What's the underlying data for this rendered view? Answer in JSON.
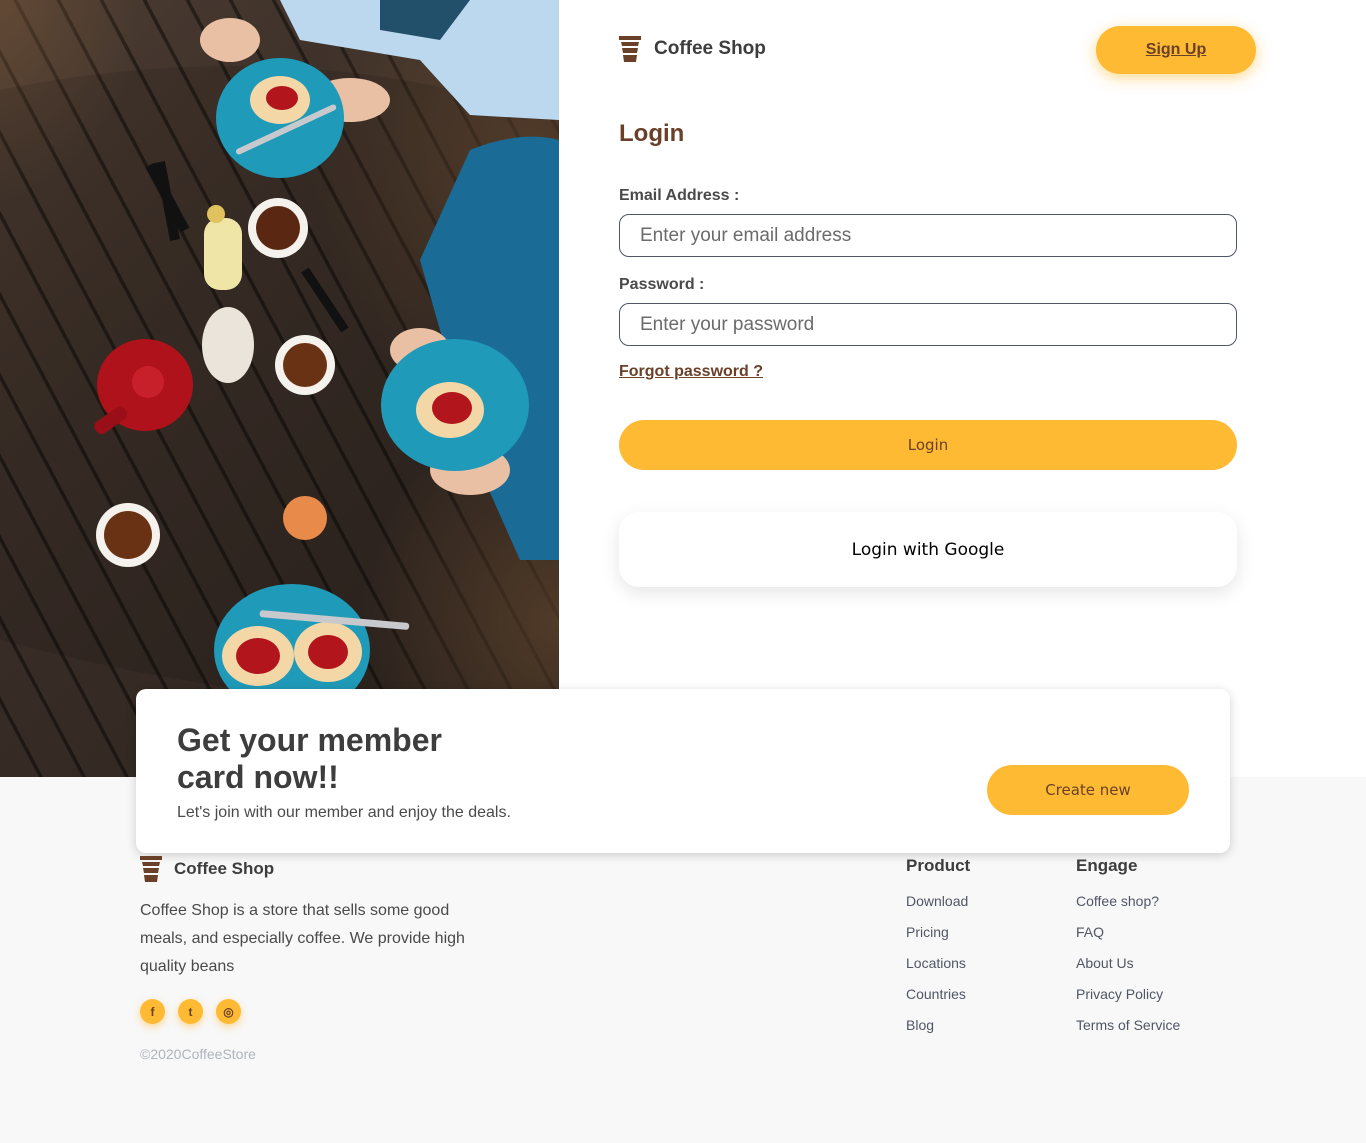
{
  "brand": {
    "name": "Coffee Shop",
    "icon": "coffee-cup-icon"
  },
  "header": {
    "signup_label": "Sign Up"
  },
  "login": {
    "title": "Login",
    "email_label": "Email Address :",
    "email_placeholder": "Enter your email address",
    "email_value": "",
    "password_label": "Password :",
    "password_placeholder": "Enter your password",
    "password_value": "",
    "forgot_label": "Forgot password ?",
    "login_label": "Login",
    "google_label": "Login with Google"
  },
  "member": {
    "title": "Get your member card now!!",
    "subtitle": "Let's join with our member and enjoy the deals.",
    "button_label": "Create new"
  },
  "footer": {
    "brand_name": "Coffee Shop",
    "description": "Coffee Shop is a store that sells some good meals, and especially coffee. We provide high quality beans",
    "socials": [
      {
        "icon": "facebook-icon",
        "glyph": "f"
      },
      {
        "icon": "twitter-icon",
        "glyph": "t"
      },
      {
        "icon": "instagram-icon",
        "glyph": "◎"
      }
    ],
    "copyright": "©2020CoffeeStore",
    "product": {
      "title": "Product",
      "links": [
        "Download",
        "Pricing",
        "Locations",
        "Countries",
        "Blog"
      ]
    },
    "engage": {
      "title": "Engage",
      "links": [
        "Coffee shop?",
        "FAQ",
        "About Us",
        "Privacy Policy",
        "Terms of Service"
      ]
    }
  },
  "colors": {
    "accent": "#ffba33",
    "brown": "#6a4029",
    "footer_bg": "#f8f8f8"
  }
}
